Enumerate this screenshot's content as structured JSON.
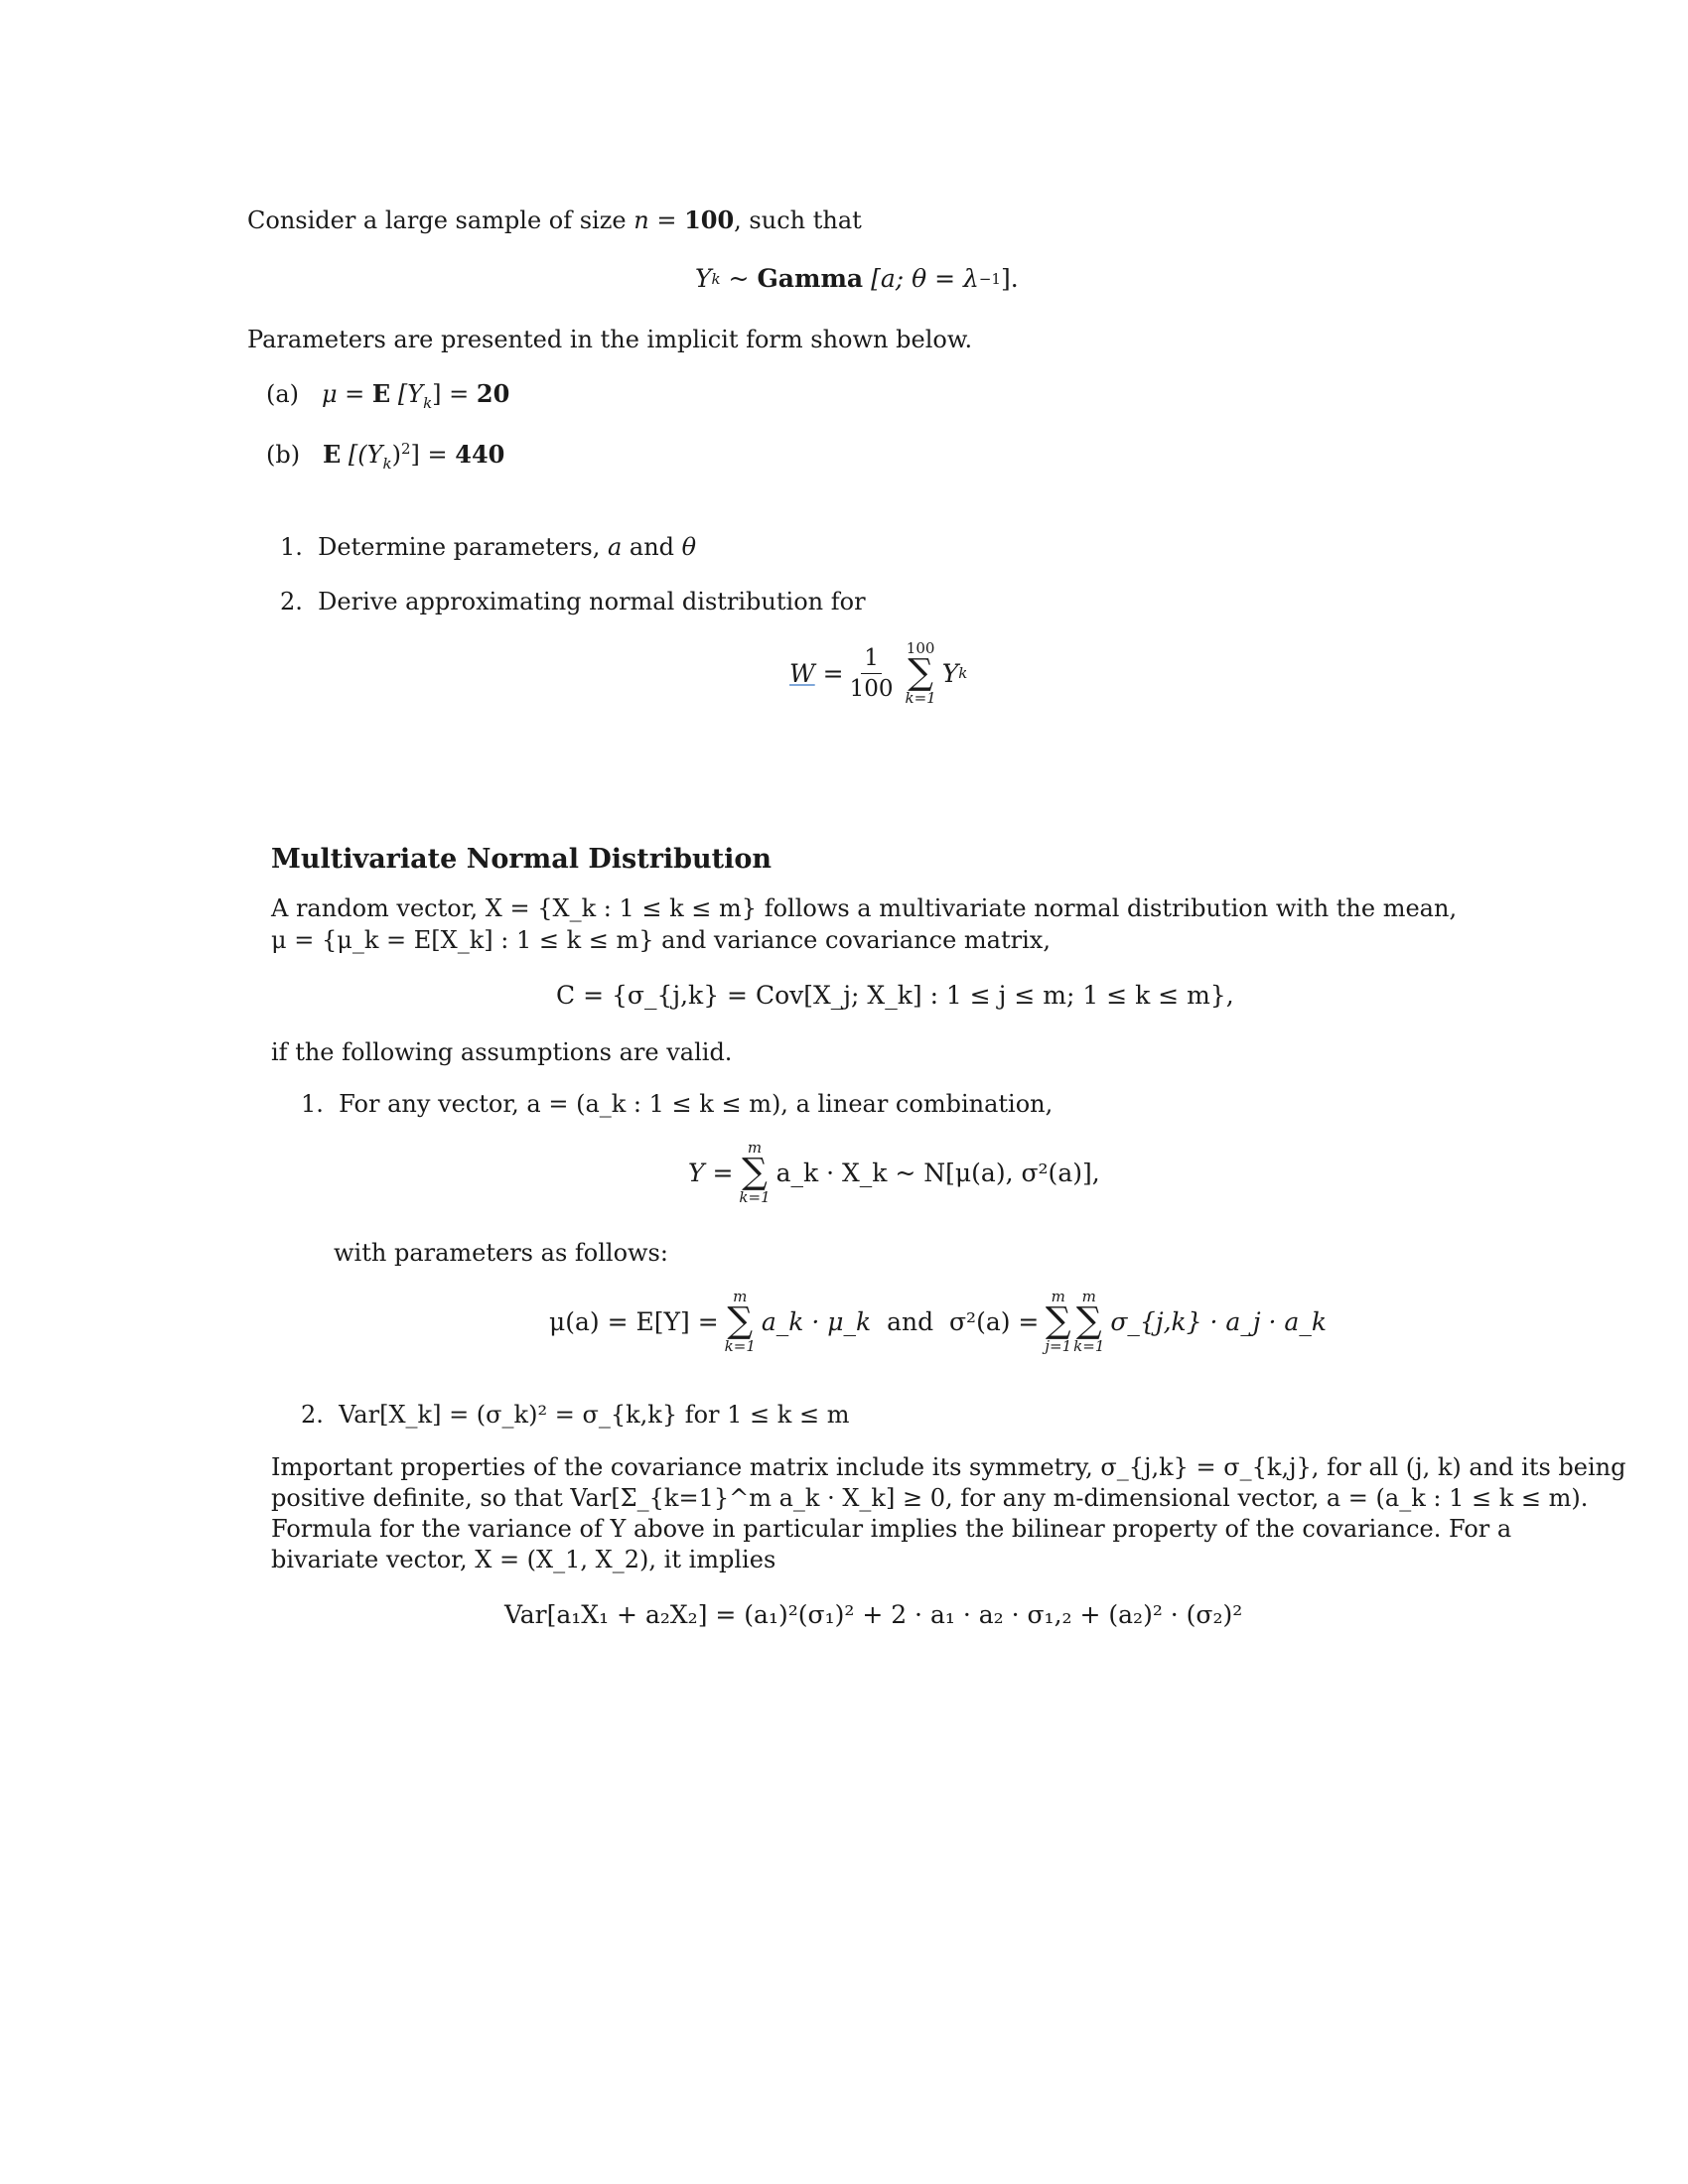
{
  "problem": {
    "intro": "Consider a large sample of size",
    "n_symbol": "n",
    "n_value": "100",
    "intro_end": ", such that",
    "dist_var": "Y",
    "dist_sub": "k",
    "dist_name": "Gamma",
    "dist_params": "[a; θ = λ",
    "dist_exp": "−1",
    "dist_close": "].",
    "params_text": "Parameters are presented in the implicit form shown below.",
    "conditions": [
      {
        "label": "(a)",
        "lhs": "μ = ",
        "op": "E",
        "arg": "[Y",
        "arg_sub": "k",
        "arg_end": "] = ",
        "value": "20"
      },
      {
        "label": "(b)",
        "lhs": "",
        "op": "E",
        "arg": "[(Y",
        "arg_sub": "k",
        "arg_end": ")",
        "arg_sup": "2",
        "arg_close": "] = ",
        "value": "440"
      }
    ],
    "tasks": [
      {
        "num": "1.",
        "text": "Determine parameters, ",
        "var1": "a",
        "mid": " and ",
        "var2": "θ"
      },
      {
        "num": "2.",
        "text": "Derive approximating normal distribution for"
      }
    ],
    "w_formula": {
      "lhs": "W",
      "eq": "=",
      "num": "1",
      "den": "100",
      "upper": "100",
      "lower": "k=1",
      "term": "Y",
      "term_sub": "k"
    }
  },
  "section": {
    "heading": "Multivariate Normal Distribution",
    "para1_line1": "A random vector, X = {X_k : 1 ≤ k ≤ m} follows a multivariate normal distribution with the mean,",
    "para1_line2": "μ = {μ_k = E[X_k] : 1 ≤ k ≤ m} and variance covariance matrix,",
    "cov_formula": "C = {σ_{j,k} = Cov[X_j; X_k] : 1 ≤ j ≤ m; 1 ≤ k ≤ m},",
    "assumptions_intro": "if the following assumptions are valid.",
    "assumption1_num": "1.",
    "assumption1_text": "For any vector, a = (a_k : 1 ≤ k ≤ m), a linear combination,",
    "y_formula": {
      "lhs": "Y =",
      "upper": "m",
      "lower": "k=1",
      "rhs": "a_k · X_k ~ N[μ(a), σ²(a)],"
    },
    "with_params": "with parameters as follows:",
    "param_formula": {
      "mu_lhs": "μ(a) = E[Y] =",
      "mu_upper": "m",
      "mu_lower": "k=1",
      "mu_rhs": "a_k · μ_k",
      "and": "and",
      "sigma_lhs": "σ²(a) =",
      "s_upper1": "m",
      "s_lower1": "j=1",
      "s_upper2": "m",
      "s_lower2": "k=1",
      "sigma_rhs": "σ_{j,k} · a_j · a_k"
    },
    "assumption2_num": "2.",
    "assumption2_text": "Var[X_k] = (σ_k)² = σ_{k,k} for 1 ≤ k ≤ m",
    "properties_lines": [
      "Important properties of the covariance matrix include its symmetry, σ_{j,k} = σ_{k,j}, for all (j, k) and its being",
      "positive definite, so that Var[Σ_{k=1}^m a_k · X_k] ≥ 0, for any m-dimensional vector, a = (a_k : 1 ≤ k ≤ m).",
      "Formula for the variance of Y above in particular implies the bilinear property of the covariance. For a",
      "bivariate vector, X = (X_1, X_2), it implies"
    ],
    "var_formula": "Var[a₁X₁ + a₂X₂] = (a₁)²(σ₁)² + 2 · a₁ · a₂ · σ₁,₂ + (a₂)² · (σ₂)²"
  }
}
